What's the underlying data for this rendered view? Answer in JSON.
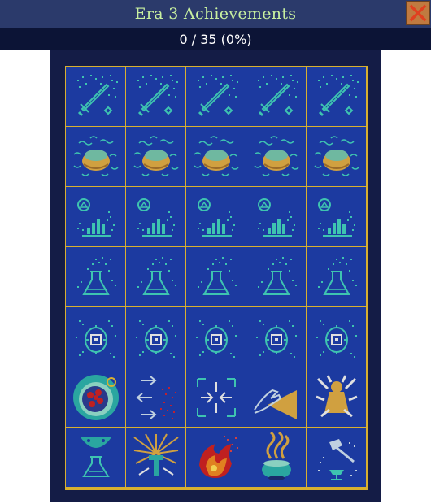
{
  "window": {
    "title": "Era 3 Achievements",
    "progress": "0 / 35 (0%)",
    "unlocked_count": 0,
    "total_count": 35
  },
  "colors": {
    "title_text": "#c8f0a0",
    "tile_bg": "#1c3aa0",
    "tile_border": "#d8b030",
    "locked_outline": "#3ec4b0",
    "close_button": "#c07a40"
  },
  "rows": [
    {
      "icon": "sword-sparkle-icon",
      "count": 5,
      "state": "locked"
    },
    {
      "icon": "golden-bowl-icon",
      "count": 5,
      "state": "locked"
    },
    {
      "icon": "bar-chart-icon",
      "count": 5,
      "state": "locked"
    },
    {
      "icon": "flask-sparkle-icon",
      "count": 5,
      "state": "locked"
    },
    {
      "icon": "target-circle-icon",
      "count": 5,
      "state": "locked"
    },
    {
      "icons": [
        "red-orb-icon",
        "arrows-scatter-icon",
        "converge-arrows-icon",
        "hand-cone-icon",
        "golden-figure-icon"
      ],
      "state": "mixed"
    },
    {
      "icons": [
        "smiley-flask-icon",
        "golden-sunburst-icon",
        "fireball-icon",
        "smoking-cauldron-icon",
        "hammer-anvil-icon"
      ],
      "state": "mixed"
    }
  ]
}
